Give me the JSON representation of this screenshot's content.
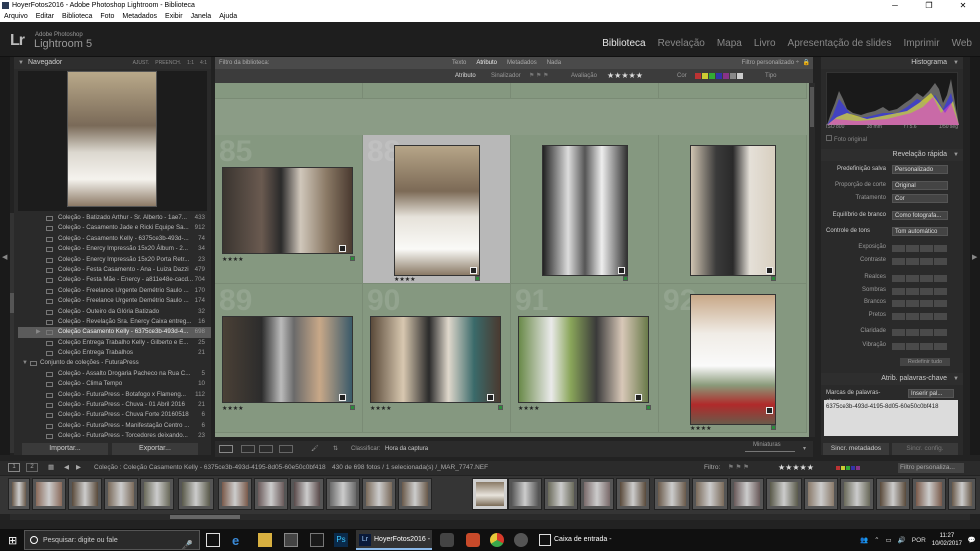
{
  "window": {
    "title": "HoyerFotos2016 - Adobe Photoshop Lightroom - Biblioteca",
    "controls": [
      "─",
      "❐",
      "✕"
    ]
  },
  "menu": [
    "Arquivo",
    "Editar",
    "Biblioteca",
    "Foto",
    "Metadados",
    "Exibir",
    "Janela",
    "Ajuda"
  ],
  "identity": {
    "logo": "Lr",
    "brand_small": "Adobe Photoshop",
    "brand_big": "Lightroom 5"
  },
  "modules": [
    "Biblioteca",
    "Revelação",
    "Mapa",
    "Livro",
    "Apresentação de slides",
    "Imprimir",
    "Web"
  ],
  "left_panel": {
    "navigator_title": "Navegador",
    "navigator_options": [
      "AJUST.",
      "PREENCH.",
      "1:1",
      "4:1"
    ],
    "collections": [
      {
        "name": "Coleção - Batizado Arthur - Sr. Alberto - 1ae7...",
        "count": "433"
      },
      {
        "name": "Coleção - Casamento Jade e Ricki Equipe Sa...",
        "count": "912"
      },
      {
        "name": "Coleção - Casamento Kelly - 6375ce3b-493d-...",
        "count": "74"
      },
      {
        "name": "Coleção - Enercy Impressão 15x20 Álbum - 2...",
        "count": "34"
      },
      {
        "name": "Coleção - Enercy Impressão 15x20 Porta Retr...",
        "count": "23"
      },
      {
        "name": "Coleção - Festa Casamento - Ana - Luiza Dazzi",
        "count": "479"
      },
      {
        "name": "Coleção - Festa Mãe - Enercy - a811e48e-cacd...",
        "count": "704"
      },
      {
        "name": "Coleção - Freelance Urgente Demétrio Saulo ...",
        "count": "170"
      },
      {
        "name": "Coleção - Freelance Urgente Demétrio Saulo ...",
        "count": "174"
      },
      {
        "name": "Coleção - Outeiro da Glória Batizado",
        "count": "32"
      },
      {
        "name": "Coleção - Revelação Sra. Enercy Caixa entreg...",
        "count": "16"
      },
      {
        "name": "Coleção Casamento Kelly - 6375ce3b-493d-4...",
        "count": "698",
        "selected": true
      },
      {
        "name": "Coleção Entrega Trabalho Kelly - Gilberto e E...",
        "count": "25"
      },
      {
        "name": "Coleção Entrega Trabalhos",
        "count": "21"
      },
      {
        "name": "Conjunto de coleções - FuturaPress",
        "count": "",
        "set": true
      },
      {
        "name": "Coleção - Assalto Drogaria Pacheco na Rua C...",
        "count": "5"
      },
      {
        "name": "Coleção - Clima Tempo",
        "count": "10"
      },
      {
        "name": "Coleção - FuturaPress - Botafogo x Flameng...",
        "count": "112"
      },
      {
        "name": "Coleção - FuturaPress - Chuva - 01 Abril 2016",
        "count": "21"
      },
      {
        "name": "Coleção - FuturaPress - Chuva Forte 20160518",
        "count": "6"
      },
      {
        "name": "Coleção - FuturaPress - Manifestação Centro ...",
        "count": "6"
      },
      {
        "name": "Coleção - FuturaPress - Torcedores deixando...",
        "count": "23"
      }
    ],
    "import_label": "Importar...",
    "export_label": "Exportar..."
  },
  "filter_bar": {
    "title": "Filtro da biblioteca:",
    "tabs": [
      "Texto",
      "Atributo",
      "Metadados",
      "Nada"
    ],
    "active_tab": "Atributo",
    "preset": "Filtro personalizado ÷",
    "attr_label": "Atributo",
    "flag_label": "Sinalizador",
    "rating_label": "Avaliação",
    "rating_stars": "★★★★★",
    "color_label": "Cor",
    "type_label": "Tipo"
  },
  "grid": {
    "cell_numbers": [
      "85",
      "88",
      "",
      "",
      "89",
      "90",
      "91",
      "92"
    ],
    "top_stars": [
      "★★★★",
      "★★★★",
      "★★★★",
      "★★★★"
    ],
    "row1_stars": [
      "★★★★",
      "★★★★",
      "",
      ""
    ],
    "row2_stars": [
      "★★★★",
      "★★★★",
      "★★★★",
      "★★★★"
    ]
  },
  "toolbar": {
    "sort_label": "Classificar:",
    "sort_value": "Hora da captura",
    "thumb_label": "Miniaturas"
  },
  "right_panel": {
    "histogram_title": "Histograma",
    "histo_info": [
      "ISO 800",
      "38 mm",
      "f / 5.6",
      "1/50 seg"
    ],
    "original_photo": "Foto original",
    "quick_develop_title": "Revelação rápida",
    "saved_preset_label": "Predefinição salva",
    "saved_preset_value": "Personalizado",
    "crop_label": "Proporção de corte",
    "crop_value": "Original",
    "treatment_label": "Tratamento",
    "treatment_value": "Cor",
    "wb_label": "Equilíbrio de branco",
    "wb_value": "Como fotografa...",
    "tone_label": "Controle de tons",
    "tone_value": "Tom automático",
    "tone_rows": [
      "Exposição",
      "Contraste",
      "Realces",
      "Sombras",
      "Brancos",
      "Pretos",
      "Claridade",
      "Vibração"
    ],
    "reset_label": "Redefinir tudo",
    "keywords_title": "Atrib. palavras-chave",
    "kw_tags_label": "Marcas de palavras-chave",
    "kw_tags_value": "Inserir pal...",
    "kw_value": "6375ce3b-493d-4195-8d05-60e50c0bf418",
    "sync_meta": "Sincr. metadados",
    "sync_settings": "Sincr. config."
  },
  "film_header": {
    "pages": [
      "1",
      "2"
    ],
    "source": "Coleção : Coleção Casamento Kelly - 6375ce3b-493d-4195-8d05-60e50c0bf418",
    "count": "430 de 698 fotos / 1 selecionada(s) /_MAR_7747.NEF",
    "filter_label": "Filtro:",
    "filter_stars": "★★★★★",
    "filter_preset": "Filtro personaliza..."
  },
  "taskbar": {
    "search_placeholder": "Pesquisar: digite ou fale",
    "task_lr": "HoyerFotos2016 - ...",
    "task_mail": "Caixa de entrada - ...",
    "lang": "POR",
    "time": "11:27",
    "date": "10/02/2017"
  },
  "colors": {
    "grid_bg": "#8b9c86",
    "selected_cell": "#b8b8b8",
    "flag_green": "#2a8b3a"
  }
}
